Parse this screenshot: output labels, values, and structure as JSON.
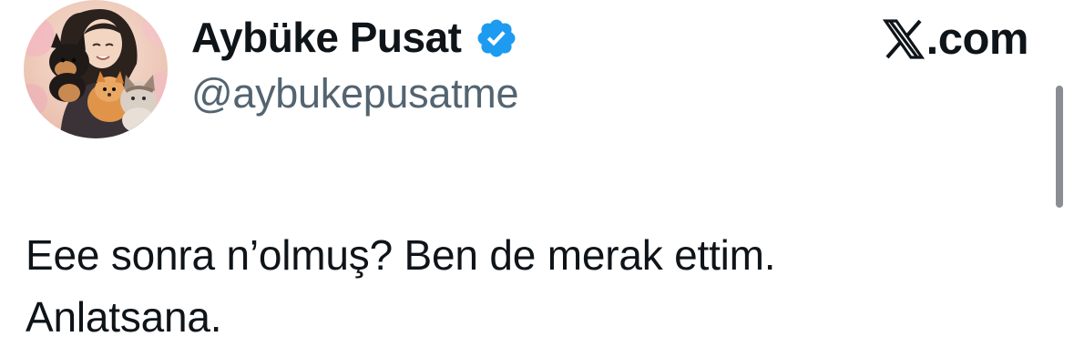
{
  "profile": {
    "display_name": "Aybüke Pusat",
    "handle": "@aybukepusatme",
    "verified": true,
    "avatar_icon": "avatar-illustration-girl-with-dogs-and-cat",
    "verified_icon": "verified-badge-icon"
  },
  "brand": {
    "logo_icon": "x-logo-icon",
    "text": ".com"
  },
  "tweet": {
    "line1": "Eee sonra n’olmuş? Ben de merak ettim.",
    "line2": "Anlatsana."
  },
  "colors": {
    "text_primary": "#0f1419",
    "text_secondary": "#536471",
    "verified_blue": "#1d9bf0",
    "scrollbar": "#8a8d91"
  }
}
